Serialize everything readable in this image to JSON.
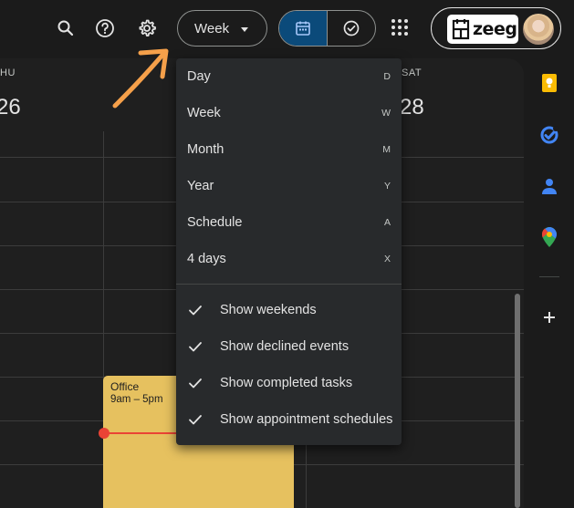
{
  "toolbar": {
    "view_selector_label": "Week",
    "brand_name": "zeeg"
  },
  "week_header": {
    "left_day_abbr": "HU",
    "left_day_num": "26",
    "right_day_abbr": "SAT",
    "right_day_num": "28"
  },
  "event": {
    "title": "Office",
    "time": "9am – 5pm",
    "color": "#e6c15f"
  },
  "view_menu": {
    "items": [
      {
        "label": "Day",
        "shortcut": "D"
      },
      {
        "label": "Week",
        "shortcut": "W"
      },
      {
        "label": "Month",
        "shortcut": "M"
      },
      {
        "label": "Year",
        "shortcut": "Y"
      },
      {
        "label": "Schedule",
        "shortcut": "A"
      },
      {
        "label": "4 days",
        "shortcut": "X"
      }
    ],
    "toggles": [
      {
        "label": "Show weekends",
        "checked": true
      },
      {
        "label": "Show declined events",
        "checked": true
      },
      {
        "label": "Show completed tasks",
        "checked": true
      },
      {
        "label": "Show appointment schedules",
        "checked": true
      }
    ]
  },
  "icons": [
    "search-icon",
    "help-icon",
    "gear-icon",
    "calendar-icon",
    "tasks-check-icon",
    "apps-grid-icon",
    "keep-icon",
    "tasks-icon",
    "contacts-icon",
    "maps-icon",
    "add-icon",
    "annotation-arrow-icon"
  ],
  "colors": {
    "accent_blue": "#0b4a7a",
    "event_yellow": "#e6c15f",
    "now_line": "#ea4335",
    "annotation_orange": "#f5a04a"
  }
}
